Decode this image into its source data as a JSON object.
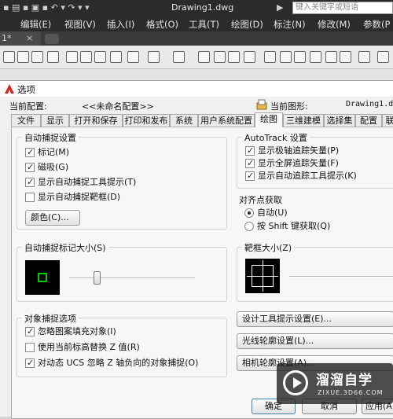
{
  "app": {
    "title": "Drawing1.dwg",
    "search_placeholder": "键入关键字或短语",
    "menu": [
      "编辑(E)",
      "视图(V)",
      "插入(I)",
      "格式(O)",
      "工具(T)",
      "绘图(D)",
      "标注(N)",
      "修改(M)",
      "参数(P"
    ],
    "doc_tab": "1*",
    "doc_tab_close": "×"
  },
  "dialog": {
    "title": "选项",
    "current_profile_label": "当前配置:",
    "current_profile_value": "<<未命名配置>>",
    "current_drawing_label": "当前图形:",
    "current_drawing_value": "Drawing1.dwg",
    "tabs": [
      "文件",
      "显示",
      "打开和保存",
      "打印和发布",
      "系统",
      "用户系统配置",
      "绘图",
      "三维建模",
      "选择集",
      "配置",
      "联"
    ],
    "active_tab": "绘图"
  },
  "autosnap": {
    "title": "自动捕捉设置",
    "marker": "标记(M)",
    "magnet": "磁吸(G)",
    "tooltip": "显示自动捕捉工具提示(T)",
    "aperture": "显示自动捕捉靶框(D)",
    "color_button": "颜色(C)...",
    "marker_checked": true,
    "magnet_checked": true,
    "tooltip_checked": true,
    "aperture_checked": false
  },
  "autotrack": {
    "title": "AutoTrack 设置",
    "polar": "显示极轴追踪矢量(P)",
    "fullscreen": "显示全屏追踪矢量(F)",
    "tooltip": "显示自动追踪工具提示(K)",
    "polar_checked": true,
    "fullscreen_checked": true,
    "tooltip_checked": true
  },
  "alignment": {
    "title": "对齐点获取",
    "auto": "自动(U)",
    "shift": "按 Shift 键获取(Q)",
    "selected": "auto"
  },
  "marker_size": {
    "title": "自动捕捉标记大小(S)",
    "slider_level": 0.22,
    "marker_color": "#00cc00"
  },
  "aperture_size": {
    "title": "靶框大小(Z)",
    "slider_level": 0.3
  },
  "object_snap": {
    "title": "对象捕捉选项",
    "ignore_hatch": "忽略图案填充对象(I)",
    "use_elevation": "使用当前标高替换 Z 值(R)",
    "ignore_z": "对动态 UCS 忽略 Z 轴负向的对象捕捉(O)",
    "ignore_hatch_checked": true,
    "use_elevation_checked": false,
    "ignore_z_checked": true
  },
  "buttons": {
    "design_tooltip": "设计工具提示设置(E)...",
    "lightglyph": "光线轮廓设置(L)...",
    "camera": "相机轮廓设置(A)...",
    "ok": "确定",
    "cancel": "取消",
    "apply": "应用(A)"
  },
  "watermark": {
    "line1": "溜溜自学",
    "line2": "ZIXUE.3D66.COM"
  },
  "colors": {
    "accent_red": "#d9241c",
    "dark_chrome": "#2b2b2b"
  }
}
